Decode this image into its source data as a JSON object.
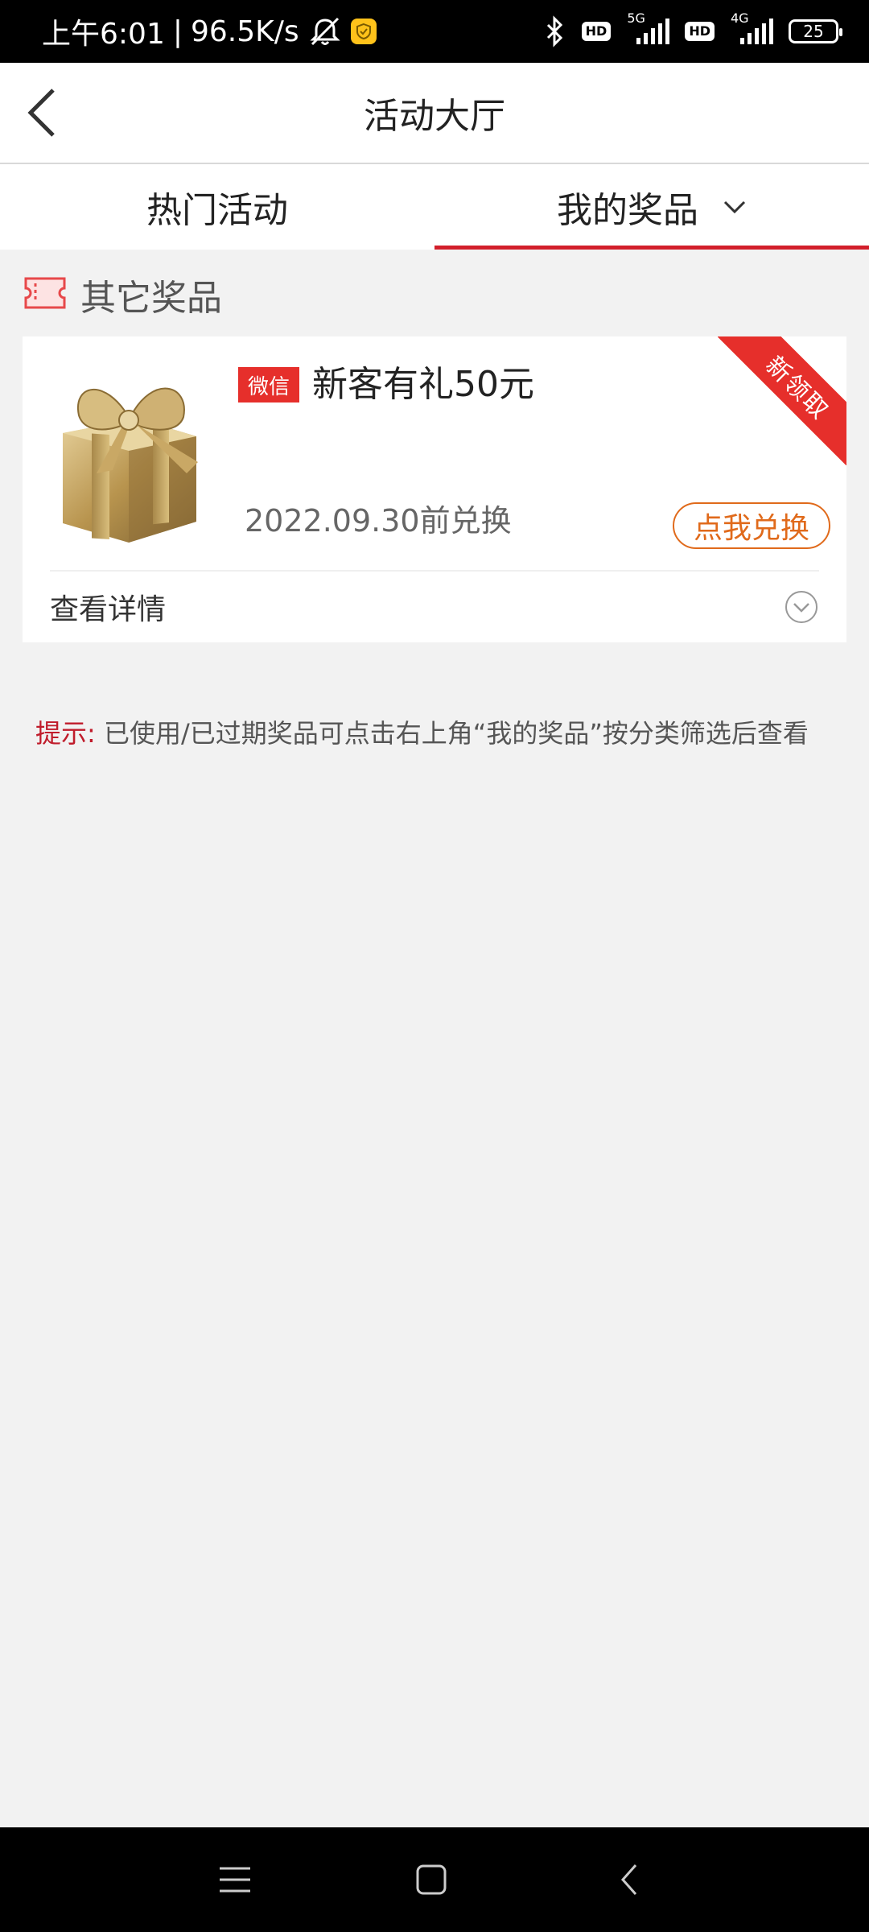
{
  "status_bar": {
    "time": "上午6:01",
    "separator": "|",
    "net_speed": "96.5K/s",
    "network_5g": "5G",
    "network_4g": "4G",
    "hd_label": "HD",
    "battery": "25"
  },
  "header": {
    "title": "活动大厅",
    "back_icon": "chevron-left-icon"
  },
  "tabs": [
    {
      "label": "热门活动",
      "active": false
    },
    {
      "label": "我的奖品",
      "active": true
    }
  ],
  "section": {
    "title": "其它奖品",
    "icon": "ticket-icon"
  },
  "prize": {
    "source_badge": "微信",
    "name": "新客有礼50元",
    "corner_ribbon": "新领取",
    "expire_text": "2022.09.30前兑换",
    "redeem_label": "点我兑换",
    "details_label": "查看详情"
  },
  "hint": {
    "label": "提示:",
    "text": "已使用/已过期奖品可点击右上角“我的奖品”按分类筛选后查看"
  },
  "colors": {
    "accent_red": "#d21f2b",
    "ribbon_red": "#e62f2b",
    "redeem_orange": "#e06a1b",
    "background": "#f2f2f2"
  }
}
